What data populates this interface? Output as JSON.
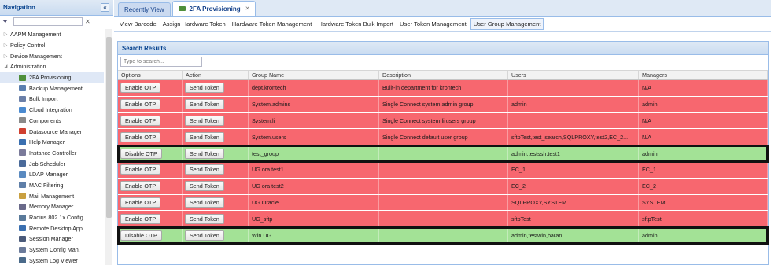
{
  "sidebar": {
    "title": "Navigation",
    "collapse_icon": "double-chevron-left-icon",
    "filter_placeholder": "",
    "filter_clear": "✕",
    "items": [
      {
        "label": "AAPM Management",
        "level": 0
      },
      {
        "label": "Policy Control",
        "level": 0
      },
      {
        "label": "Device Management",
        "level": 0
      },
      {
        "label": "Administration",
        "level": 0,
        "expanded": true
      },
      {
        "label": "2FA Provisioning",
        "level": 1,
        "selected": true,
        "icon": "card-icon",
        "color": "#4f8f3a"
      },
      {
        "label": "Backup Management",
        "level": 1,
        "icon": "disk-icon",
        "color": "#5a7fb0"
      },
      {
        "label": "Bulk Import",
        "level": 1,
        "icon": "import-icon",
        "color": "#6a7fa8"
      },
      {
        "label": "Cloud Integration",
        "level": 1,
        "icon": "cloud-icon",
        "color": "#4a8ad0"
      },
      {
        "label": "Components",
        "level": 1,
        "icon": "components-icon",
        "color": "#8a8a8a"
      },
      {
        "label": "Datasource Manager",
        "level": 1,
        "icon": "datasource-icon",
        "color": "#d04030"
      },
      {
        "label": "Help Manager",
        "level": 1,
        "icon": "help-icon",
        "color": "#3a6fb0"
      },
      {
        "label": "Instance Controller",
        "level": 1,
        "icon": "instance-icon",
        "color": "#7a7a9a"
      },
      {
        "label": "Job Scheduler",
        "level": 1,
        "icon": "scheduler-icon",
        "color": "#4a6a9a"
      },
      {
        "label": "LDAP Manager",
        "level": 1,
        "icon": "ldap-icon",
        "color": "#5a8ac0"
      },
      {
        "label": "MAC Filtering",
        "level": 1,
        "icon": "filter-icon",
        "color": "#5f7fa8"
      },
      {
        "label": "Mail Management",
        "level": 1,
        "icon": "mail-icon",
        "color": "#c9a040"
      },
      {
        "label": "Memory Manager",
        "level": 1,
        "icon": "memory-icon",
        "color": "#6a6a8a"
      },
      {
        "label": "Radius 802.1x Config",
        "level": 1,
        "icon": "radius-icon",
        "color": "#5a7a9a"
      },
      {
        "label": "Remote Desktop App",
        "level": 1,
        "icon": "remote-desktop-icon",
        "color": "#3a6fb0"
      },
      {
        "label": "Session Manager",
        "level": 1,
        "icon": "session-icon",
        "color": "#4a5a7a"
      },
      {
        "label": "System Config Man.",
        "level": 1,
        "icon": "config-icon",
        "color": "#6a7a9a"
      },
      {
        "label": "System Log Viewer",
        "level": 1,
        "icon": "log-icon",
        "color": "#4a6a8a"
      }
    ]
  },
  "tabs": [
    {
      "label": "Recently View",
      "active": false
    },
    {
      "label": "2FA Provisioning",
      "active": true,
      "close": "✕"
    }
  ],
  "subtabs": [
    {
      "label": "View Barcode",
      "active": false
    },
    {
      "label": "Assign Hardware Token",
      "active": false
    },
    {
      "label": "Hardware Token Management",
      "active": false
    },
    {
      "label": "Hardware Token Bulk Import",
      "active": false
    },
    {
      "label": "User Token Management",
      "active": false
    },
    {
      "label": "User Group Management",
      "active": true
    }
  ],
  "results": {
    "title": "Search Results",
    "search_placeholder": "Type to search...",
    "columns": [
      "Options",
      "Action",
      "Group Name",
      "Description",
      "Users",
      "Managers"
    ],
    "colors": {
      "disabled": "#f7676f",
      "enabled": "#a3e296"
    },
    "rows": [
      {
        "option": "Enable OTP",
        "action": "Send Token",
        "group": "dept.krontech",
        "description": "Built-in department for krontech",
        "users": "",
        "managers": "N/A",
        "status": "red",
        "highlight": false
      },
      {
        "option": "Enable OTP",
        "action": "Send Token",
        "group": "System.admins",
        "description": "Single Connect system admin group",
        "users": "admin",
        "managers": "admin",
        "status": "red",
        "highlight": false
      },
      {
        "option": "Enable OTP",
        "action": "Send Token",
        "group": "System.li",
        "description": "Single Connect system li users group",
        "users": "",
        "managers": "N/A",
        "status": "red",
        "highlight": false
      },
      {
        "option": "Enable OTP",
        "action": "Send Token",
        "group": "System.users",
        "description": "Single Connect default user group",
        "users": "sftpTest,test_search,SQLPROXY,test2,EC_2...",
        "managers": "N/A",
        "status": "red",
        "highlight": false
      },
      {
        "option": "Disable OTP",
        "action": "Send Token",
        "group": "test_group",
        "description": "",
        "users": "admin,testssh,test1",
        "managers": "admin",
        "status": "green",
        "highlight": true
      },
      {
        "option": "Enable OTP",
        "action": "Send Token",
        "group": "UG ora test1",
        "description": "",
        "users": "EC_1",
        "managers": "EC_1",
        "status": "red",
        "highlight": false
      },
      {
        "option": "Enable OTP",
        "action": "Send Token",
        "group": "UG ora test2",
        "description": "",
        "users": "EC_2",
        "managers": "EC_2",
        "status": "red",
        "highlight": false
      },
      {
        "option": "Enable OTP",
        "action": "Send Token",
        "group": "UG Oracle",
        "description": "",
        "users": "SQLPROXY,SYSTEM",
        "managers": "SYSTEM",
        "status": "red",
        "highlight": false
      },
      {
        "option": "Enable OTP",
        "action": "Send Token",
        "group": "UG_sftp",
        "description": "",
        "users": "sftpTest",
        "managers": "sftpTest",
        "status": "red",
        "highlight": false
      },
      {
        "option": "Disable OTP",
        "action": "Send Token",
        "group": "Win UG",
        "description": "",
        "users": "admin,testwin,baran",
        "managers": "admin",
        "status": "green",
        "highlight": true
      }
    ]
  }
}
